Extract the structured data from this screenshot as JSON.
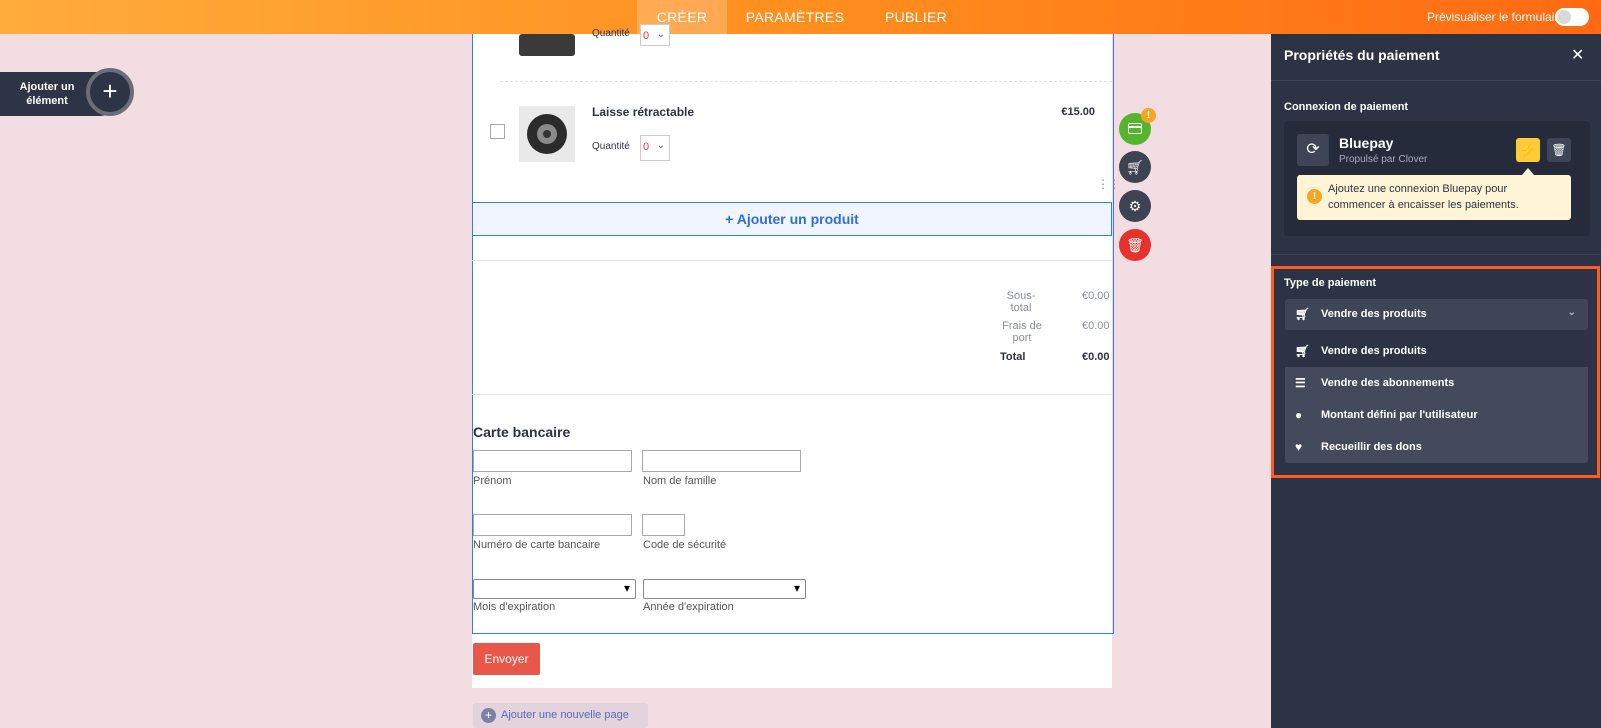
{
  "topbar": {
    "tabs": [
      "CRÉER",
      "PARAMÈTRES",
      "PUBLIER"
    ],
    "preview_label": "Prévisualiser le formulaire"
  },
  "add_element": {
    "label": "Ajouter un élément",
    "icon": "plus-icon"
  },
  "products": [
    {
      "name": "",
      "qty_label": "Quantité",
      "qty_value": "0"
    },
    {
      "name": "Laisse rétractable",
      "price": "€15.00",
      "qty_label": "Quantité",
      "qty_value": "0"
    }
  ],
  "add_product_label": "+ Ajouter un produit",
  "totals": {
    "subtotal_label": "Sous-total",
    "subtotal_value": "€0.00",
    "shipping_label": "Frais de port",
    "shipping_value": "€0.00",
    "total_label": "Total",
    "total_value": "€0.00"
  },
  "credit_card": {
    "title": "Carte bancaire",
    "first_name": "Prénom",
    "last_name": "Nom de famille",
    "card_number": "Numéro de carte bancaire",
    "security_code": "Code de sécurité",
    "exp_month": "Mois d'expiration",
    "exp_year": "Année d'expiration"
  },
  "submit_label": "Envoyer",
  "new_page_label": "Ajouter une nouvelle page",
  "tools": {
    "badge": "!",
    "icons": [
      "payment-card-icon",
      "cart-icon",
      "gear-icon",
      "trash-icon"
    ]
  },
  "panel": {
    "title": "Propriétés du paiement",
    "connection_label": "Connexion de paiement",
    "gateway_name": "Bluepay",
    "gateway_sub": "Propulsé par Clover",
    "warning": "Ajoutez une connexion Bluepay pour commencer à encaisser les paiements.",
    "payment_type_label": "Type de paiement",
    "selected_type": "Vendre des produits",
    "options": [
      {
        "label": "Vendre des produits",
        "icon": "cart-icon"
      },
      {
        "label": "Vendre des abonnements",
        "icon": "subscription-icon"
      },
      {
        "label": "Montant défini par l'utilisateur",
        "icon": "coins-icon"
      },
      {
        "label": "Recueillir des dons",
        "icon": "heart-icon"
      }
    ]
  },
  "colors": {
    "accent_orange": "#ff8f1f",
    "panel_bg": "#2c3345",
    "highlight": "#ff5a1f",
    "submit": "#e8574a",
    "canvas": "#f2dde3"
  }
}
